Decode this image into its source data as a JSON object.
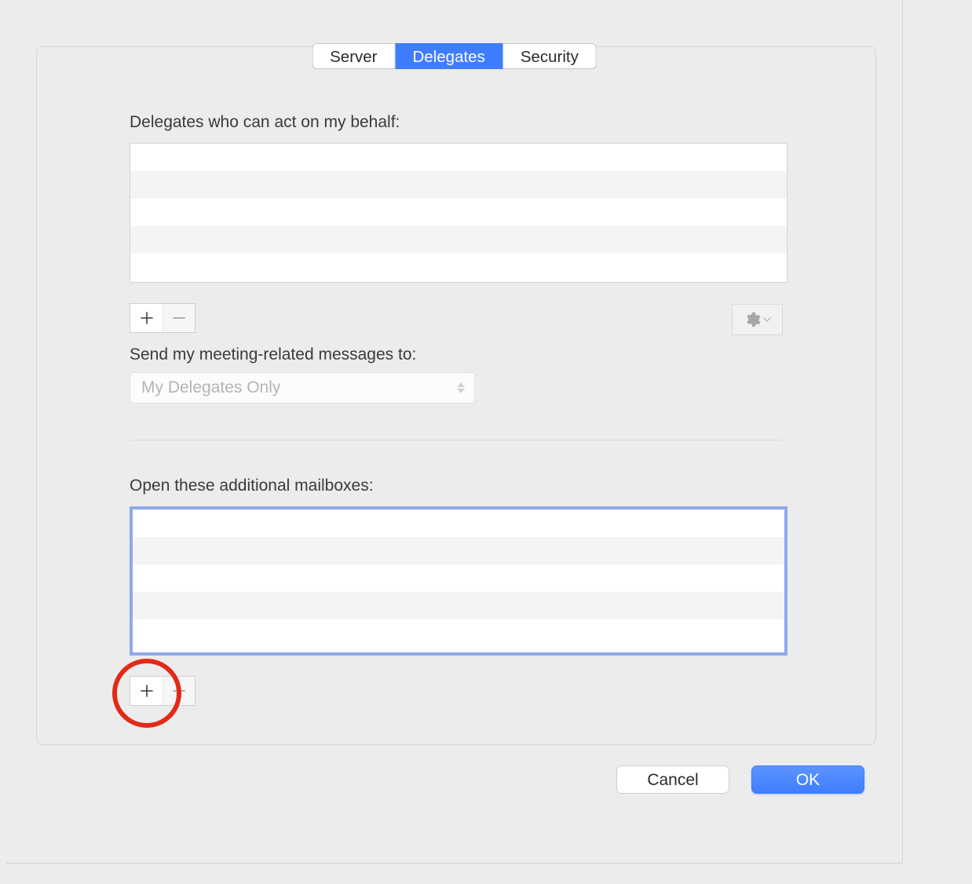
{
  "tabs": {
    "server": "Server",
    "delegates": "Delegates",
    "security": "Security",
    "active": "delegates"
  },
  "delegates": {
    "label": "Delegates who can act on my behalf:",
    "items": []
  },
  "meeting": {
    "label": "Send my meeting-related messages to:",
    "selected": "My Delegates Only"
  },
  "mailboxes": {
    "label": "Open these additional mailboxes:",
    "items": []
  },
  "buttons": {
    "cancel": "Cancel",
    "ok": "OK"
  },
  "annotation": {
    "target": "add-mailbox-button"
  }
}
